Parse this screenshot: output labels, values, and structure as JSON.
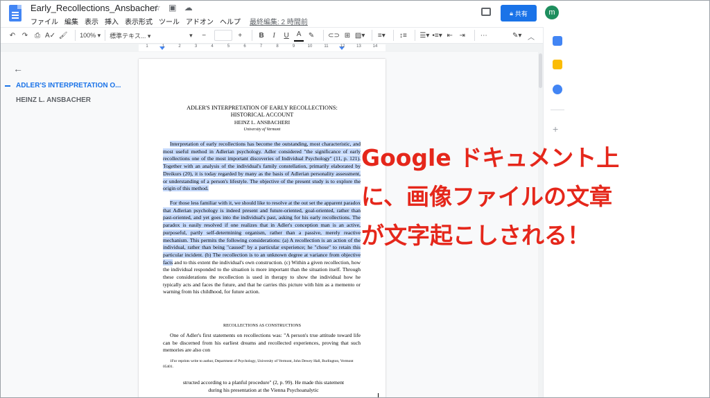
{
  "header": {
    "title": "Early_Recollections_Ansbacher",
    "menus": [
      "ファイル",
      "編集",
      "表示",
      "挿入",
      "表示形式",
      "ツール",
      "アドオン",
      "ヘルプ"
    ],
    "last_edit": "最終編集: 2 時間前",
    "share_label": "共有",
    "avatar_letter": "m",
    "title_icons": [
      "star-icon",
      "folder-move-icon",
      "cloud-status-icon"
    ]
  },
  "toolbar": {
    "zoom": "100%",
    "style": "標準テキス...",
    "font_size": "",
    "bold": "B",
    "italic": "I",
    "underline": "U",
    "text_color": "A",
    "more": "⋯"
  },
  "ruler": {
    "numbers": [
      "1",
      "1",
      "2",
      "3",
      "4",
      "5",
      "6",
      "7",
      "8",
      "9",
      "10",
      "11",
      "12",
      "13",
      "14"
    ]
  },
  "outline": {
    "items": [
      {
        "label": "ADLER'S INTERPRETATION O..."
      },
      {
        "label": "HEINZ L. ANSBACHER"
      }
    ]
  },
  "document": {
    "title_line1": "ADLER'S INTERPRETATION OF EARLY RECOLLECTIONS:",
    "title_line2": "HISTORICAL ACCOUNT",
    "author": "HEINZ L. ANSBACHERI",
    "affiliation": "University of Vermont",
    "para1": "Interpretation of early recollections has become the outstanding, most characteristic, and most useful method in Adlerian psychology. Adler considered \"the significance of early recollections one of the most important discoveries of Individual Psychology\" (11, p. 121). Together with an analysis of the individual's family constellation, primarily elaborated by Dreikurs (20), it is today regarded by many as the basis of Adlerian personality assessment, or understanding of a person's lifestyle. The objective of the present study is to explore the origin of this method.",
    "para2_hl": "For those less familiar with it, we should like to resolve at the out set the apparent paradox that Adlerian psychology is indeed present and future-oriented, goal-oriented, rather than past-oriented, and yet goes into the individual's past, asking for his early recollections. The paradox is easily resolved if one realizes that in Adler's conception man is an active, purposeful, partly self-determining organism, rather than a passive, merely reactive mechanism. This permits the following considerations: (a) A recollection is an action of the individual, rather than being \"caused\" by a particular experience; he \"chose\" to retain this particular incident. (b) The recollection is to an unknown degree at variance from objective facts",
    "para2_rest": " and to this extent the individual's own construction. (c) Within a given recollection, how the individual responded to the situation is more important than the situation itself. Through these considerations the recollection is used in therapy to show the individual how he typically acts and faces the future, and that he carries this picture with him as a memento or warning from his childhood, for future action.",
    "section_head": "RECOLLECTIONS AS CONSTRUCTIONS",
    "para3": "One of Adler's first statements on recollections was: \"A person's true attitude toward life can be discerned from his earliest dreams and recollected experiences, proving that such memories are also con",
    "footnote": "1For reprints write to author, Department of Psychology, University of Vermont, John Dewey Hall, Burlington, Vermont 05401.",
    "para4": "structed according to a planful procedure\" (2, p. 99). He made this statement during his presentation at the Vienna Psychoanalytic"
  },
  "overlay": {
    "line1": "Google ドキュメント上",
    "line2": "に、画像ファイルの文章",
    "line3": "が文字起こしされる！",
    "color": "#e5271b"
  }
}
